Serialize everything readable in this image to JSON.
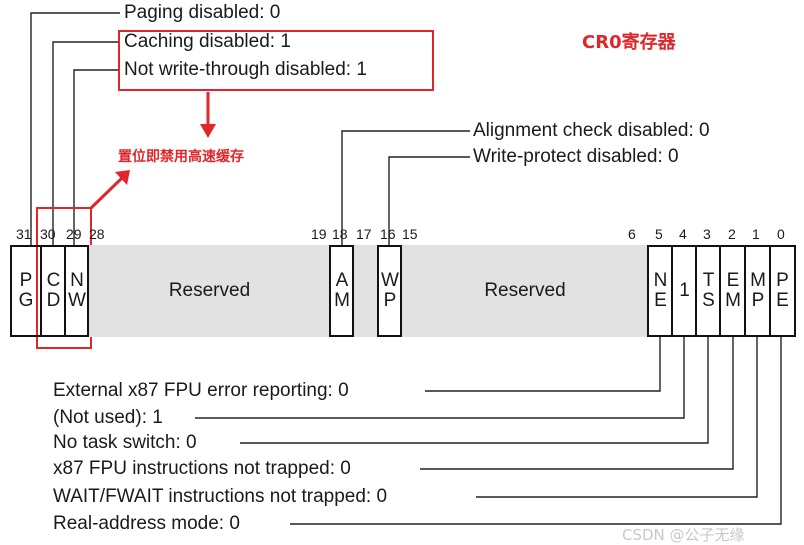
{
  "top_labels": {
    "pg": "Paging disabled: 0",
    "cd": "Caching disabled: 1",
    "nw": "Not write-through disabled: 1",
    "am": "Alignment check disabled: 0",
    "wp": "Write-protect disabled: 0"
  },
  "title": "CR0寄存器",
  "annotation": "置位即禁用高速缓存",
  "bit_numbers": [
    "31",
    "30",
    "29",
    "28",
    "19",
    "18",
    "17",
    "16",
    "15",
    "6",
    "5",
    "4",
    "3",
    "2",
    "1",
    "0"
  ],
  "register": {
    "pg": [
      "P",
      "G"
    ],
    "cd": [
      "C",
      "D"
    ],
    "nw": [
      "N",
      "W"
    ],
    "reserved_high": "Reserved",
    "am": [
      "A",
      "M"
    ],
    "wp": [
      "W",
      "P"
    ],
    "reserved_low": "Reserved",
    "ne": [
      "N",
      "E"
    ],
    "bit4": "1",
    "ts": [
      "T",
      "S"
    ],
    "em": [
      "E",
      "M"
    ],
    "mp": [
      "M",
      "P"
    ],
    "pe": [
      "P",
      "E"
    ]
  },
  "bottom_labels": {
    "ne": "External x87 FPU error reporting: 0",
    "notused": "(Not used): 1",
    "ts": "No task switch: 0",
    "em": "x87 FPU instructions not trapped: 0",
    "mp": "WAIT/FWAIT instructions not trapped: 0",
    "pe": "Real-address mode: 0"
  },
  "watermark": "CSDN @公子无缘",
  "colors": {
    "accent": "#e0262a",
    "reserved_fill": "#e2e2e2",
    "line": "#111111"
  }
}
